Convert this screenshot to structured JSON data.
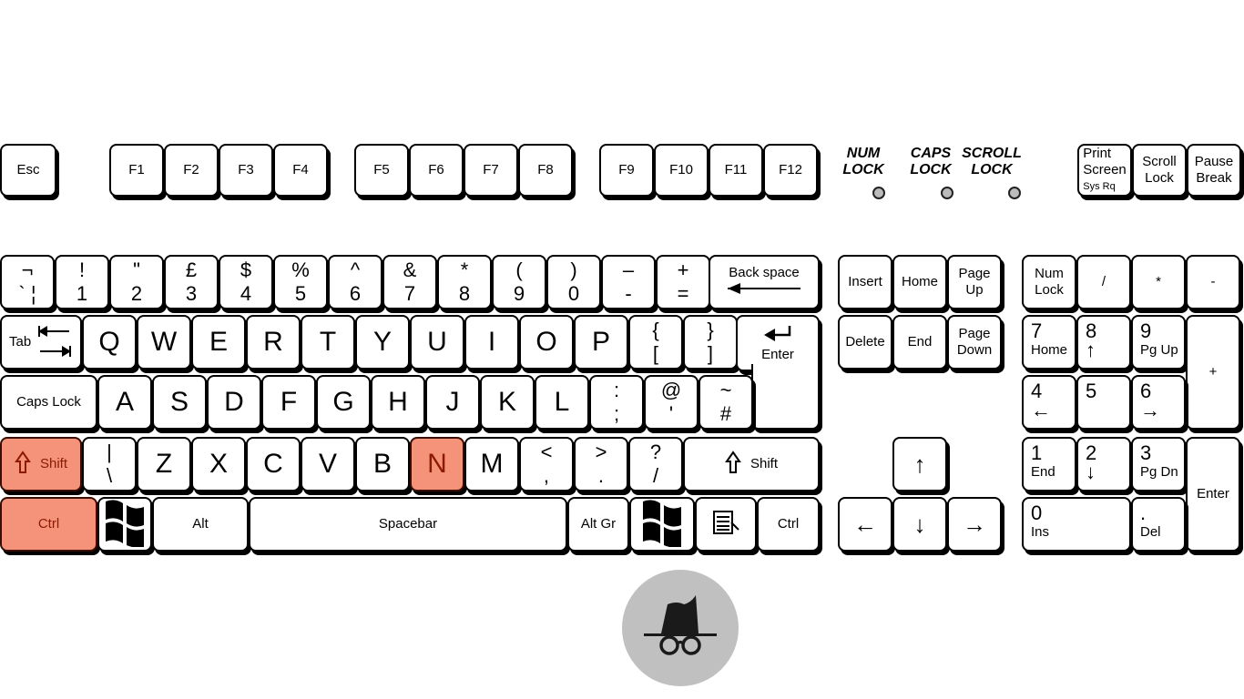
{
  "colors": {
    "pressed_key": "#f4937a",
    "pressed_text": "#8b1a00",
    "key": "#ffffff",
    "outline": "#000000",
    "incognito_badge": "#c0c0c0"
  },
  "shortcut_icon": "incognito-icon",
  "function_row": [
    {
      "label": "Esc"
    },
    {
      "label": "F1"
    },
    {
      "label": "F2"
    },
    {
      "label": "F3"
    },
    {
      "label": "F4"
    },
    {
      "label": "F5"
    },
    {
      "label": "F6"
    },
    {
      "label": "F7"
    },
    {
      "label": "F8"
    },
    {
      "label": "F9"
    },
    {
      "label": "F10"
    },
    {
      "label": "F11"
    },
    {
      "label": "F12"
    }
  ],
  "indicators": [
    {
      "label": "NUM\nLOCK",
      "state": "off"
    },
    {
      "label": "CAPS\nLOCK",
      "state": "off"
    },
    {
      "label": "SCROLL\nLOCK",
      "state": "off"
    }
  ],
  "system_keys": [
    {
      "label": "Print\nScreen",
      "sub": "Sys Rq"
    },
    {
      "label": "Scroll\nLock"
    },
    {
      "label": "Pause\nBreak"
    }
  ],
  "number_row": [
    {
      "top": "¬",
      "bottom": "` ¦"
    },
    {
      "top": "!",
      "bottom": "1"
    },
    {
      "top": "\"",
      "bottom": "2"
    },
    {
      "top": "£",
      "bottom": "3"
    },
    {
      "top": "$",
      "bottom": "4"
    },
    {
      "top": "%",
      "bottom": "5"
    },
    {
      "top": "^",
      "bottom": "6"
    },
    {
      "top": "&",
      "bottom": "7"
    },
    {
      "top": "*",
      "bottom": "8"
    },
    {
      "top": "(",
      "bottom": "9"
    },
    {
      "top": ")",
      "bottom": "0"
    },
    {
      "top": "–",
      "bottom": "-"
    },
    {
      "top": "+",
      "bottom": "="
    },
    {
      "label": "Back space",
      "icon": "left-arrow-icon"
    }
  ],
  "top_row": [
    {
      "label": "Tab",
      "icon": "tab-arrows-icon"
    },
    {
      "label": "Q"
    },
    {
      "label": "W"
    },
    {
      "label": "E"
    },
    {
      "label": "R"
    },
    {
      "label": "T"
    },
    {
      "label": "Y"
    },
    {
      "label": "U"
    },
    {
      "label": "I"
    },
    {
      "label": "O"
    },
    {
      "label": "P"
    },
    {
      "top": "{",
      "bottom": "["
    },
    {
      "top": "}",
      "bottom": "]"
    },
    {
      "label": "Enter",
      "icon": "enter-arrow-icon"
    }
  ],
  "home_row": [
    {
      "label": "Caps Lock"
    },
    {
      "label": "A"
    },
    {
      "label": "S"
    },
    {
      "label": "D"
    },
    {
      "label": "F"
    },
    {
      "label": "G"
    },
    {
      "label": "H"
    },
    {
      "label": "J"
    },
    {
      "label": "K"
    },
    {
      "label": "L"
    },
    {
      "top": ":",
      "bottom": ";"
    },
    {
      "top": "@",
      "bottom": "'"
    },
    {
      "top": "~",
      "bottom": "#"
    }
  ],
  "shift_row": [
    {
      "label": "Shift",
      "icon": "shift-arrow-icon",
      "pressed": true
    },
    {
      "top": "|",
      "bottom": "\\"
    },
    {
      "label": "Z"
    },
    {
      "label": "X"
    },
    {
      "label": "C"
    },
    {
      "label": "V"
    },
    {
      "label": "B"
    },
    {
      "label": "N",
      "pressed": true
    },
    {
      "label": "M"
    },
    {
      "top": "<",
      "bottom": ","
    },
    {
      "top": ">",
      "bottom": "."
    },
    {
      "top": "?",
      "bottom": "/"
    },
    {
      "label": "Shift",
      "icon": "shift-arrow-icon"
    }
  ],
  "bottom_row": [
    {
      "label": "Ctrl",
      "pressed": true
    },
    {
      "icon": "windows-logo-icon"
    },
    {
      "label": "Alt"
    },
    {
      "label": "Spacebar"
    },
    {
      "label": "Alt Gr"
    },
    {
      "icon": "windows-logo-icon"
    },
    {
      "icon": "context-menu-icon"
    },
    {
      "label": "Ctrl"
    }
  ],
  "navigation": [
    {
      "label": "Insert"
    },
    {
      "label": "Home"
    },
    {
      "label": "Page\nUp"
    },
    {
      "label": "Delete"
    },
    {
      "label": "End"
    },
    {
      "label": "Page\nDown"
    }
  ],
  "arrows": [
    {
      "icon": "up-arrow-icon",
      "glyph": "↑"
    },
    {
      "icon": "left-arrow-icon",
      "glyph": "←"
    },
    {
      "icon": "down-arrow-icon",
      "glyph": "↓"
    },
    {
      "icon": "right-arrow-icon",
      "glyph": "→"
    }
  ],
  "numpad": [
    {
      "label": "Num\nLock"
    },
    {
      "label": "/"
    },
    {
      "label": "*"
    },
    {
      "label": "-"
    },
    {
      "num": "7",
      "sub": "Home"
    },
    {
      "num": "8",
      "glyph": "↑"
    },
    {
      "num": "9",
      "sub": "Pg Up"
    },
    {
      "label": "+"
    },
    {
      "num": "4",
      "glyph": "←"
    },
    {
      "num": "5"
    },
    {
      "num": "6",
      "glyph": "→"
    },
    {
      "num": "1",
      "sub": "End"
    },
    {
      "num": "2",
      "glyph": "↓"
    },
    {
      "num": "3",
      "sub": "Pg Dn"
    },
    {
      "label": "Enter"
    },
    {
      "num": "0",
      "sub": "Ins"
    },
    {
      "num": ".",
      "sub": "Del"
    }
  ]
}
